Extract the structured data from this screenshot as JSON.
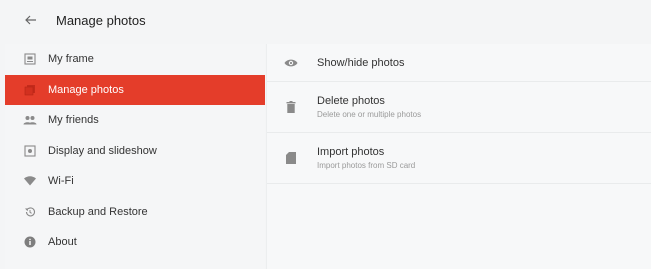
{
  "header": {
    "title": "Manage photos",
    "back_icon": "arrow-left-icon"
  },
  "sidebar": {
    "items": [
      {
        "label": "My frame",
        "icon": "frame-icon",
        "active": false
      },
      {
        "label": "Manage photos",
        "icon": "photos-icon",
        "active": true
      },
      {
        "label": "My friends",
        "icon": "people-icon",
        "active": false
      },
      {
        "label": "Display and slideshow",
        "icon": "display-icon",
        "active": false
      },
      {
        "label": "Wi-Fi",
        "icon": "wifi-icon",
        "active": false
      },
      {
        "label": "Backup and Restore",
        "icon": "restore-icon",
        "active": false
      },
      {
        "label": "About",
        "icon": "info-icon",
        "active": false
      }
    ]
  },
  "content": {
    "items": [
      {
        "label": "Show/hide photos",
        "subtitle": "",
        "icon": "eye-icon"
      },
      {
        "label": "Delete photos",
        "subtitle": "Delete one or multiple photos",
        "icon": "trash-icon"
      },
      {
        "label": "Import photos",
        "subtitle": "Import photos from SD card",
        "icon": "sd-card-icon"
      }
    ]
  },
  "colors": {
    "accent": "#e43d2a",
    "icon": "#8a8a8a",
    "background": "#f4f5f6"
  }
}
